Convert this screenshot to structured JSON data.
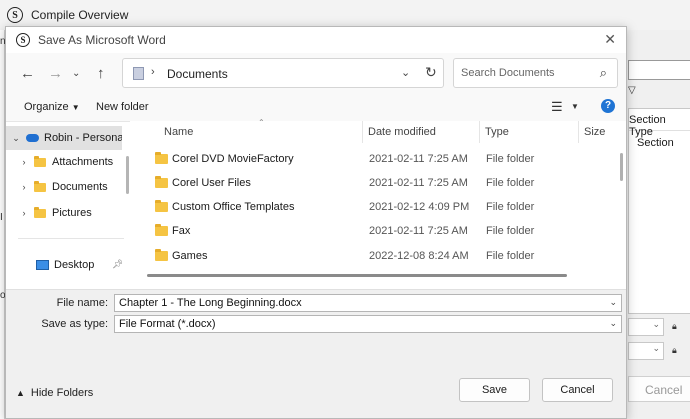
{
  "background_window": {
    "title": "Compile Overview",
    "right_panel": {
      "column_header": "Section Type",
      "cell": "Section",
      "cancel_label": "Cancel"
    }
  },
  "dialog": {
    "title": "Save As Microsoft Word",
    "address": {
      "path": "Documents"
    },
    "search": {
      "placeholder": "Search Documents"
    },
    "commands": {
      "organize": "Organize",
      "new_folder": "New folder"
    },
    "nav_pane": {
      "items": [
        {
          "label": "Robin - Personal",
          "icon": "onedrive-cloud-icon",
          "expanded": true
        },
        {
          "label": "Attachments",
          "icon": "folder-icon"
        },
        {
          "label": "Documents",
          "icon": "folder-icon"
        },
        {
          "label": "Pictures",
          "icon": "folder-icon"
        },
        {
          "label": "Desktop",
          "icon": "desktop-icon",
          "pinned": true
        }
      ]
    },
    "columns": {
      "name": "Name",
      "date": "Date modified",
      "type": "Type",
      "size": "Size"
    },
    "files": [
      {
        "name": "Corel DVD MovieFactory",
        "date": "2021-02-11 7:25 AM",
        "type": "File folder"
      },
      {
        "name": "Corel User Files",
        "date": "2021-02-11 7:25 AM",
        "type": "File folder"
      },
      {
        "name": "Custom Office Templates",
        "date": "2021-02-12 4:09 PM",
        "type": "File folder"
      },
      {
        "name": "Fax",
        "date": "2021-02-11 7:25 AM",
        "type": "File folder"
      },
      {
        "name": "Games",
        "date": "2022-12-08 8:24 AM",
        "type": "File folder"
      }
    ],
    "form": {
      "file_name_label": "File name:",
      "file_name_value": "Chapter 1 - The Long Beginning.docx",
      "save_type_label": "Save as type:",
      "save_type_value": "File Format (*.docx)"
    },
    "footer": {
      "hide_folders": "Hide Folders",
      "save": "Save",
      "cancel": "Cancel"
    }
  },
  "colors": {
    "accent": "#1f74d4",
    "folder": "#f5c443",
    "selection": "#e1e1e1"
  }
}
